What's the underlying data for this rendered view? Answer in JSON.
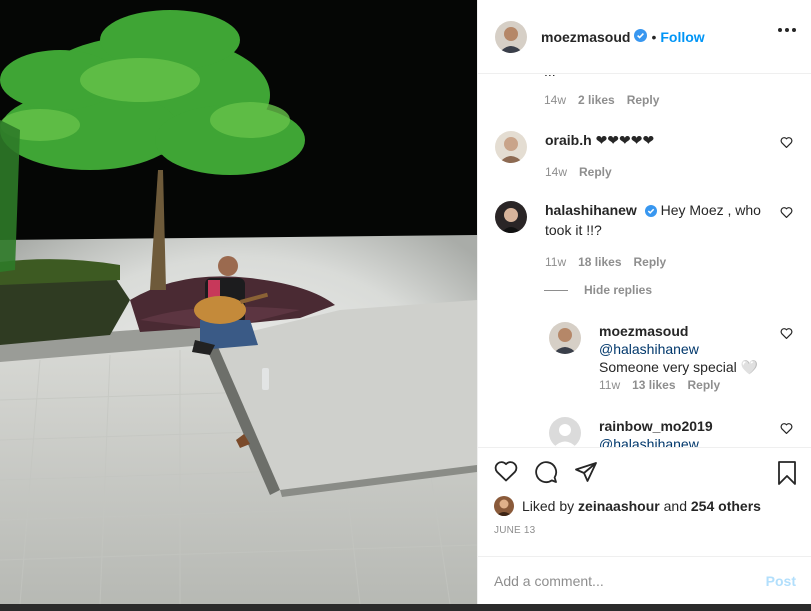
{
  "post": {
    "username": "moezmasoud",
    "verified": true,
    "separator": "•",
    "follow_label": "Follow",
    "more_icon": "more-horizontal-icon"
  },
  "comments": {
    "previous_cut_text": "...",
    "previous_meta": {
      "time": "14w",
      "likes": "2 likes",
      "reply": "Reply"
    },
    "items": [
      {
        "username": "oraib.h",
        "text": "❤❤❤❤❤",
        "time": "14w",
        "likes": "",
        "reply": "Reply"
      },
      {
        "username": "halashihanew",
        "verified": true,
        "text": "Hey Moez , who took it !!?",
        "time": "11w",
        "likes": "18 likes",
        "reply": "Reply"
      }
    ],
    "hide_replies_label": "Hide replies",
    "replies": [
      {
        "username": "moezmasoud",
        "mention": "@halashihanew",
        "text": "Someone very special 🤍",
        "time": "11w",
        "likes": "13 likes",
        "reply": "Reply"
      },
      {
        "username": "rainbow_mo2019",
        "mention": "@halashihanew",
        "text": ""
      }
    ]
  },
  "actions": {
    "liked_by_prefix": "Liked by",
    "liked_by_user": "zeinaashour",
    "liked_by_suffix": "and",
    "others": "254 others",
    "date": "JUNE 13"
  },
  "add_comment": {
    "placeholder": "Add a comment...",
    "post_label": "Post"
  },
  "colors": {
    "accent": "#0095f6",
    "post_disabled": "#b2dffc",
    "verified": "#3897f0",
    "muted": "#8e8e8e"
  }
}
